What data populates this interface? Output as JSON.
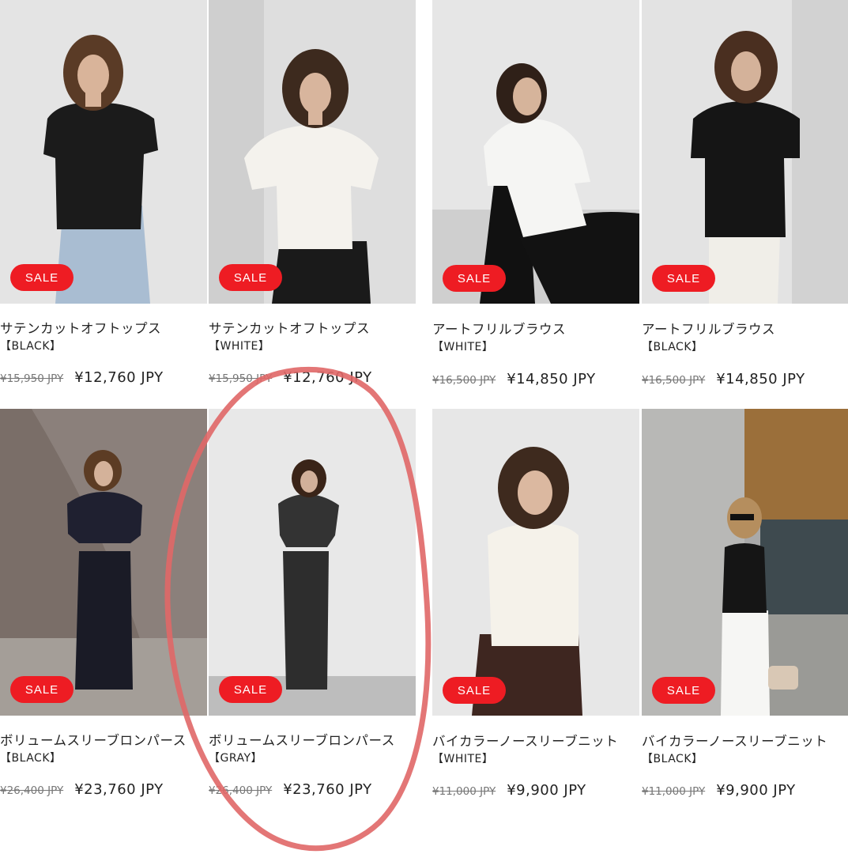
{
  "products": [
    {
      "name": "サテンカットオフトップス",
      "color": "【BLACK】",
      "old_price": "¥15,950 JPY",
      "price": "¥12,760 JPY",
      "badge": "SALE"
    },
    {
      "name": "サテンカットオフトップス",
      "color": "【WHITE】",
      "old_price": "¥15,950 JPY",
      "price": "¥12,760 JPY",
      "badge": "SALE"
    },
    {
      "name": "アートフリルブラウス",
      "color": "【WHITE】",
      "old_price": "¥16,500 JPY",
      "price": "¥14,850 JPY",
      "badge": "SALE"
    },
    {
      "name": "アートフリルブラウス",
      "color": "【BLACK】",
      "old_price": "¥16,500 JPY",
      "price": "¥14,850 JPY",
      "badge": "SALE"
    },
    {
      "name": "ボリュームスリーブロンパース",
      "color": "【BLACK】",
      "old_price": "¥26,400 JPY",
      "price": "¥23,760 JPY",
      "badge": "SALE"
    },
    {
      "name": "ボリュームスリーブロンパース",
      "color": "【GRAY】",
      "old_price": "¥26,400 JPY",
      "price": "¥23,760 JPY",
      "badge": "SALE"
    },
    {
      "name": "バイカラーノースリーブニット",
      "color": "【WHITE】",
      "old_price": "¥11,000 JPY",
      "price": "¥9,900 JPY",
      "badge": "SALE"
    },
    {
      "name": "バイカラーノースリーブニット",
      "color": "【BLACK】",
      "old_price": "¥11,000 JPY",
      "price": "¥9,900 JPY",
      "badge": "SALE"
    }
  ],
  "colors": {
    "sale_badge": "#ee1c23",
    "annotation": "#e06767"
  }
}
